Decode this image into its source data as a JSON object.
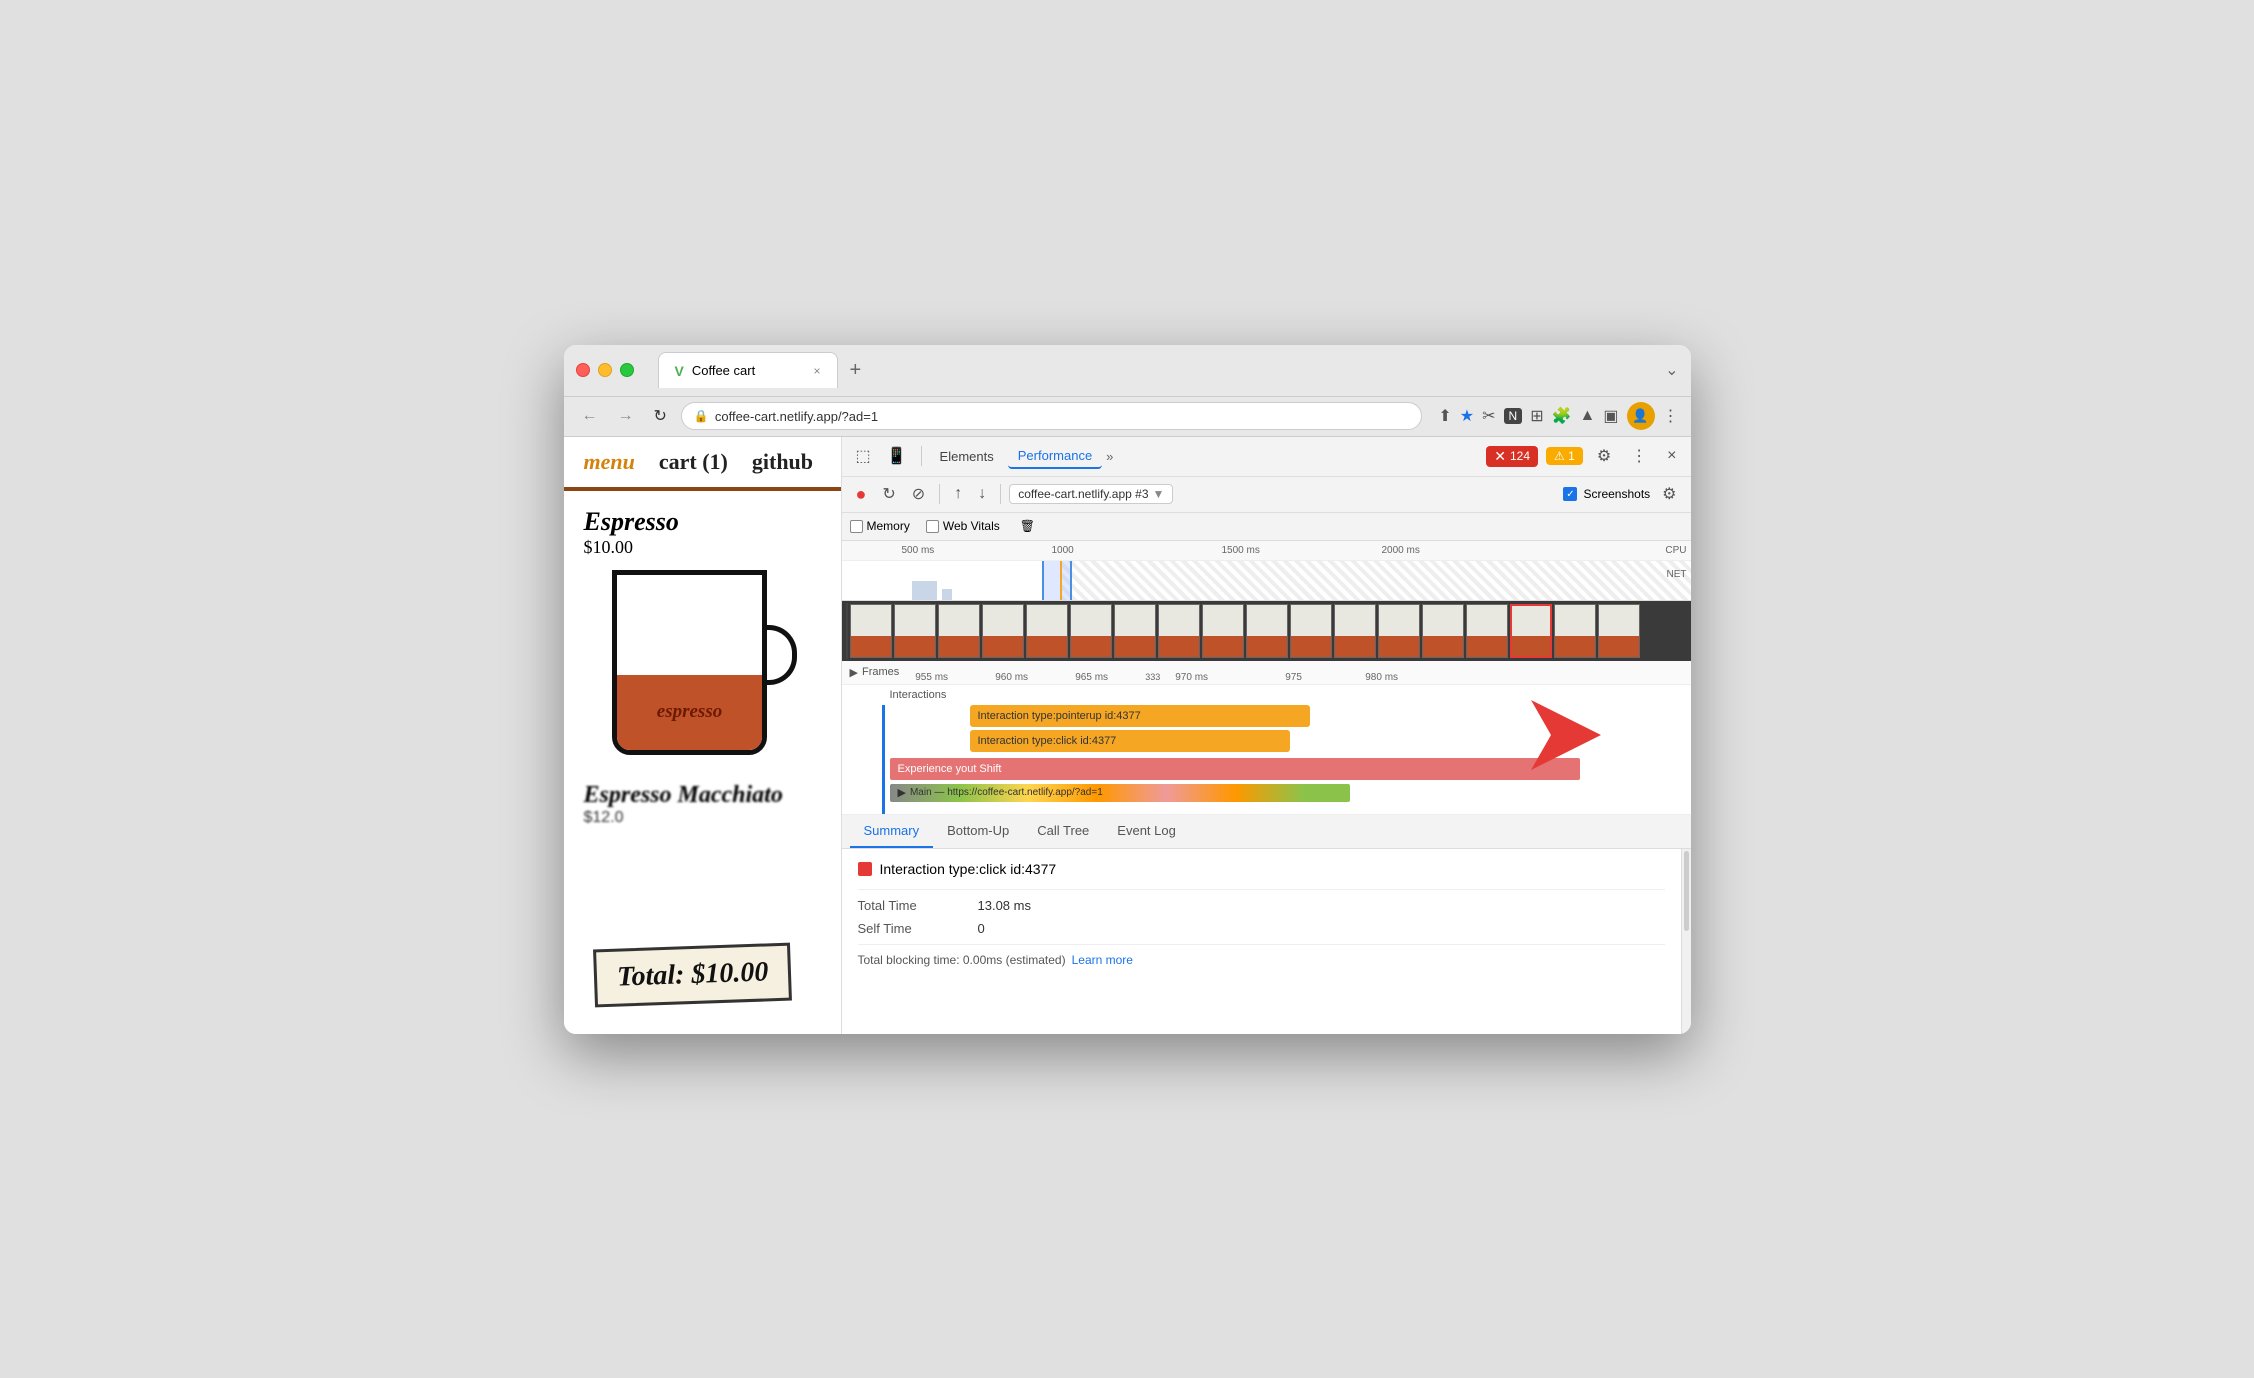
{
  "browser": {
    "traffic_lights": [
      "red",
      "yellow",
      "green"
    ],
    "tab": {
      "favicon": "V",
      "title": "Coffee cart",
      "close": "×"
    },
    "tab_new": "+",
    "tab_menu": "⌄",
    "nav_back": "←",
    "nav_forward": "→",
    "nav_refresh": "↻",
    "url": "coffee-cart.netlify.app/?ad=1",
    "lock_icon": "🔒",
    "browser_actions": [
      "share",
      "star",
      "scissors",
      "n-icon",
      "apps",
      "puzzle",
      "profile-icon",
      "profile2",
      "menu"
    ]
  },
  "website": {
    "nav": {
      "menu": "menu",
      "cart": "cart (1)",
      "github": "github"
    },
    "product1": {
      "name": "Espresso",
      "price": "$10.00",
      "cup_label": "espresso"
    },
    "product2": {
      "name": "Espresso Macchiato",
      "price": "$12.0"
    },
    "cart_total": "Total: $10.00"
  },
  "devtools": {
    "toolbar": {
      "inspect_icon": "⬚",
      "device_icon": "📱",
      "block_icon": "⊘",
      "upload_icon": "↑",
      "download_icon": "↓",
      "tabs": [
        "Elements",
        "Performance",
        "»"
      ],
      "active_tab": "Performance",
      "error_count": "124",
      "warning_count": "1",
      "settings_icon": "⚙",
      "more_icon": "⋮",
      "close_icon": "×"
    },
    "toolbar2": {
      "record_btn": "●",
      "refresh_btn": "↻",
      "block_btn": "⊘",
      "upload_btn": "↑",
      "download_btn": "↓",
      "target": "coffee-cart.netlify.app #3",
      "screenshots_label": "Screenshots",
      "settings_icon": "⚙"
    },
    "options": {
      "memory_label": "Memory",
      "web_vitals_label": "Web Vitals",
      "trash_icon": "🗑"
    },
    "timeline": {
      "markers": [
        "500 ms",
        "1000",
        "1500 ms",
        "2000 ms"
      ],
      "cpu_label": "CPU",
      "net_label": "NET"
    },
    "frames": {
      "label": "Frames",
      "ticks": [
        "955 ms",
        "960 ms",
        "965 ms",
        "333",
        "970 ms",
        "975",
        "980 ms"
      ]
    },
    "interactions": {
      "label": "Interactions",
      "bars": [
        "Interaction type:pointerup id:4377",
        "Interaction type:click id:4377"
      ],
      "experience_bar": "Experience yout Shift",
      "main_thread": "Main — https://coffee-cart.netlify.app/?ad=1"
    },
    "bottom_tabs": [
      "Summary",
      "Bottom-Up",
      "Call Tree",
      "Event Log"
    ],
    "active_bottom_tab": "Summary",
    "summary": {
      "title": "Interaction type:click id:4377",
      "color": "#e53935",
      "total_time_label": "Total Time",
      "total_time_value": "13.08 ms",
      "self_time_label": "Self Time",
      "self_time_value": "0",
      "total_blocking_label": "Total blocking time: 0.00ms (estimated)",
      "learn_more_label": "Learn more"
    }
  }
}
